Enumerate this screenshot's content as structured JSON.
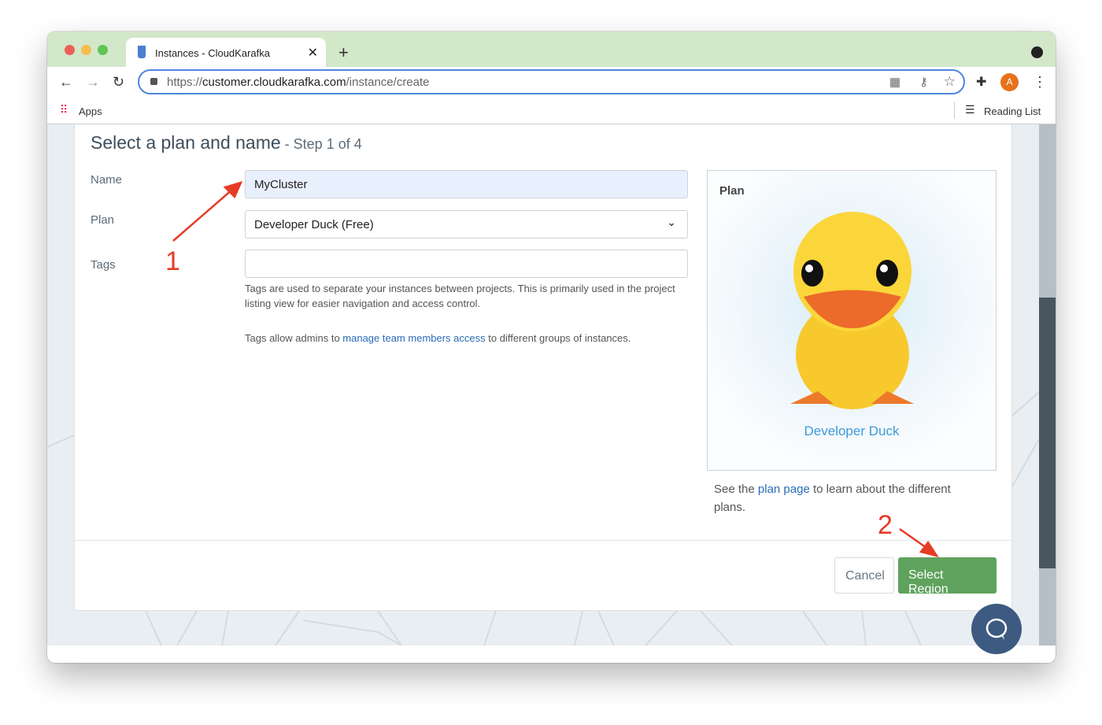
{
  "browser": {
    "tab_title": "Instances - CloudKarafka",
    "url_prefix": "https://",
    "url_host": "customer.cloudkarafka.com",
    "url_path": "/instance/create",
    "apps": "Apps",
    "reading_list": "Reading List",
    "profile_initial": "A"
  },
  "form": {
    "title": "Select a plan and name",
    "step": " - Step 1 of 4",
    "name_label": "Name",
    "name_value": "MyCluster",
    "plan_label": "Plan",
    "plan_value": "Developer Duck (Free)",
    "tags_label": "Tags",
    "tags_value": "",
    "tags_help": "Tags are used to separate your instances between projects. This is primarily used in the project listing view for easier navigation and access control.",
    "tags_help2_pre": "Tags allow admins to ",
    "tags_help2_link": "manage team members access",
    "tags_help2_post": " to different groups of instances."
  },
  "plan_panel": {
    "heading": "Plan",
    "plan_name": "Developer Duck",
    "see_pre": "See the ",
    "see_link": "plan page",
    "see_post": " to learn about the different plans."
  },
  "actions": {
    "cancel": "Cancel",
    "select_region": "Select Region"
  },
  "annotations": {
    "one": "1",
    "two": "2"
  },
  "colors": {
    "accent": "#5fa25d",
    "link": "#2a6bb8",
    "annotation": "#e63b25"
  }
}
